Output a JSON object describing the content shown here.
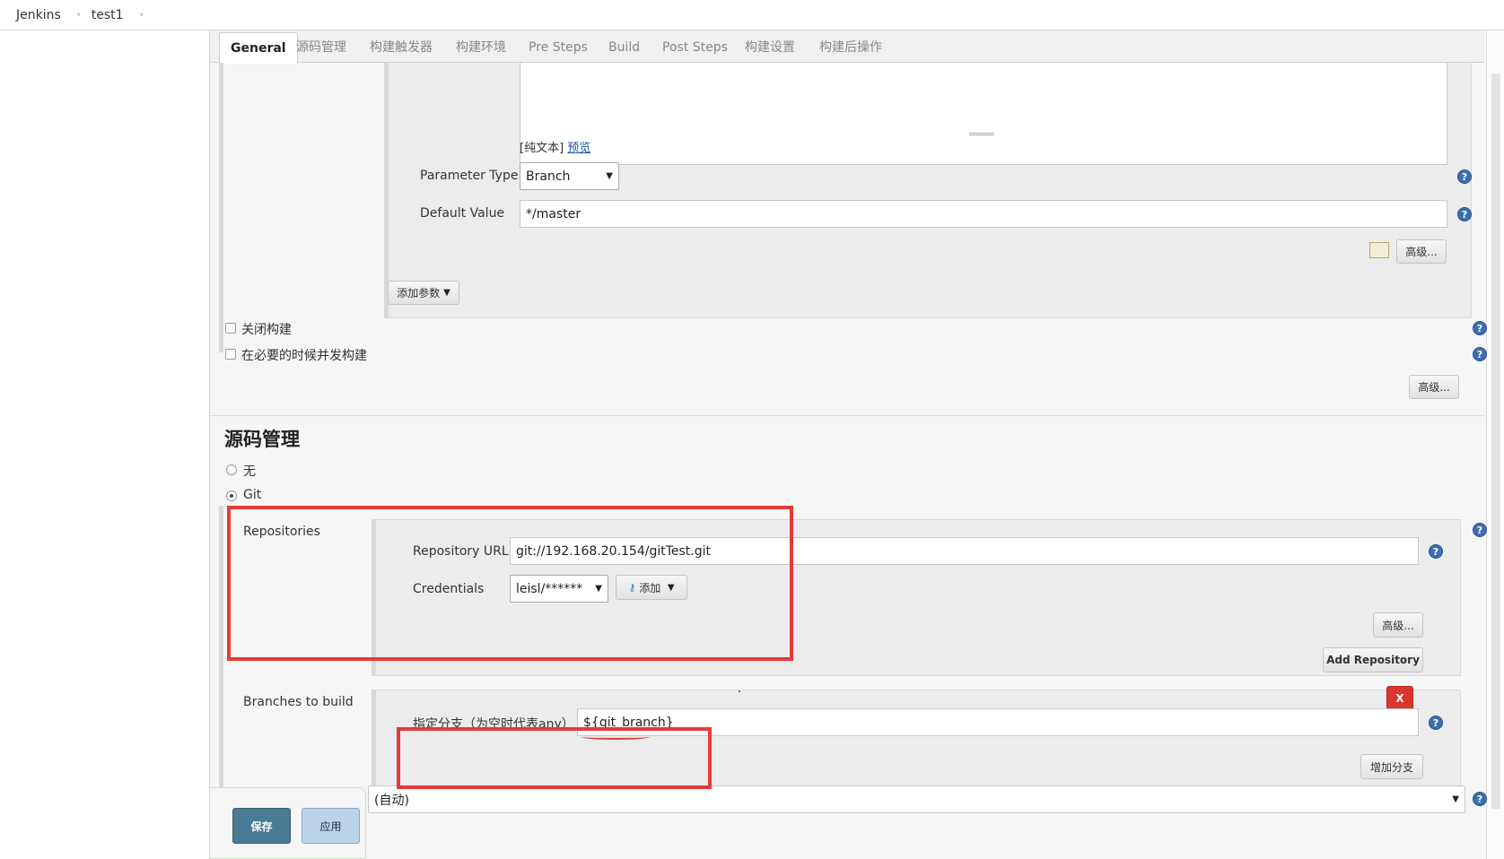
{
  "breadcrumb": {
    "items": [
      "Jenkins",
      "test1"
    ],
    "sep": "›"
  },
  "tabs": [
    {
      "label": "General"
    },
    {
      "label": "源码管理"
    },
    {
      "label": "构建触发器"
    },
    {
      "label": "构建环境"
    },
    {
      "label": "Pre Steps"
    },
    {
      "label": "Build"
    },
    {
      "label": "Post Steps"
    },
    {
      "label": "构建设置"
    },
    {
      "label": "构建后操作"
    }
  ],
  "parameter": {
    "description_plain": "[纯文本]",
    "description_preview": "预览",
    "type_label": "Parameter Type",
    "type_value": "Branch",
    "default_label": "Default Value",
    "default_value": "*/master",
    "advanced_label": "高级..."
  },
  "add_param_label": "添加参数",
  "options": {
    "disable_build": "关闭构建",
    "concurrent_build": "在必要的时候并发构建",
    "advanced_label": "高级..."
  },
  "scm": {
    "title": "源码管理",
    "none_label": "无",
    "git_label": "Git",
    "repositories_label": "Repositories",
    "repo_url_label": "Repository URL",
    "repo_url_value": "git://192.168.20.154/gitTest.git",
    "credentials_label": "Credentials",
    "credentials_value": "leisl/******",
    "add_label": "添加",
    "advanced_label": "高级...",
    "add_repository_label": "Add Repository",
    "branches_label": "Branches to build",
    "branch_spec_label": "指定分支（为空时代表any）",
    "branch_spec_value": "${git_branch}",
    "delete_label": "X",
    "add_branch_label": "增加分支",
    "browser_value": "(自动)"
  },
  "footer": {
    "save_label": "保存",
    "apply_label": "应用"
  },
  "help_glyph": "?",
  "colors": {
    "highlight": "#e53a3a",
    "save": "#4a7b94",
    "apply": "#bcd4ea",
    "help": "#3c6fb0"
  }
}
